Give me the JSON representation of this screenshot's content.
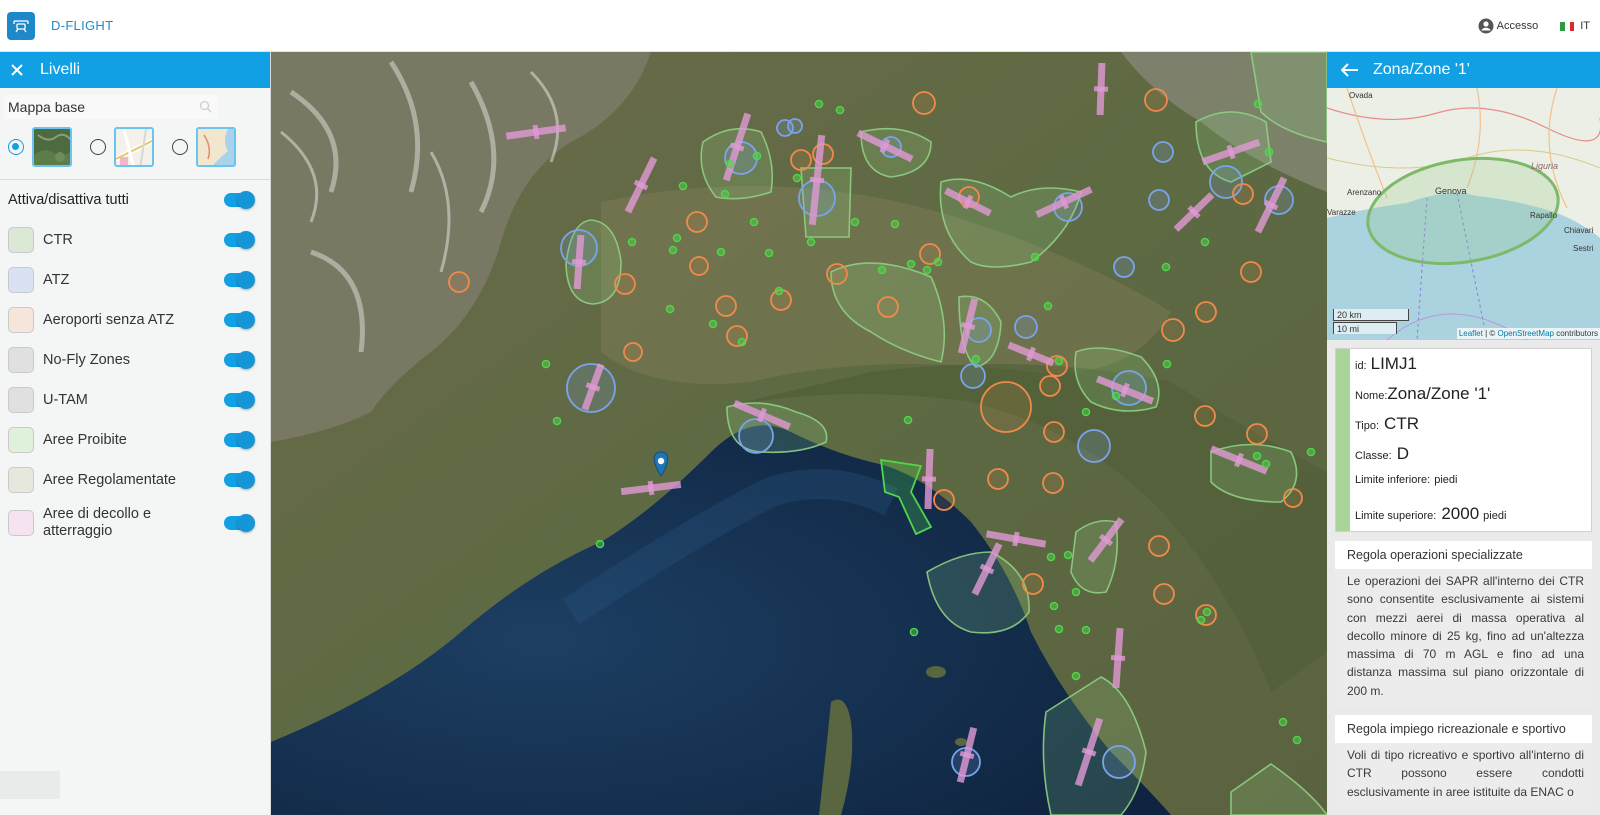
{
  "header": {
    "brand": "D-FLIGHT",
    "login_label": "Accesso",
    "lang_label": "IT"
  },
  "left_panel": {
    "title": "Livelli",
    "basemap_label": "Mappa base",
    "toggle_all_label": "Attiva/disattiva tutti",
    "layers": [
      {
        "label": "CTR",
        "color": "#dbe8d5"
      },
      {
        "label": "ATZ",
        "color": "#d9e2f3"
      },
      {
        "label": "Aeroporti senza ATZ",
        "color": "#f6e5da"
      },
      {
        "label": "No-Fly Zones",
        "color": "#e0e0e0"
      },
      {
        "label": "U-TAM",
        "color": "#e0e0e0"
      },
      {
        "label": "Aree Proibite",
        "color": "#dff1db"
      },
      {
        "label": "Aree Regolamentate",
        "color": "#e6e8dc"
      },
      {
        "label": "Aree di decollo e atterraggio",
        "color": "#f5e3f1"
      }
    ]
  },
  "right_panel": {
    "title": "Zona/Zone '1'",
    "minimap": {
      "places": [
        "Ovada",
        "Arenzano",
        "Genova",
        "Liguria",
        "Varazze",
        "Rapallo",
        "Chiavari",
        "Sestri"
      ],
      "scale_km": "20 km",
      "scale_mi": "10 mi",
      "attrib_leaflet": "Leaflet",
      "attrib_sep": " | © ",
      "attrib_osm": "OpenStreetMap",
      "attrib_contrib": " contributors"
    },
    "info": {
      "id_label": "id:",
      "id_value": "LIMJ1",
      "name_label": "Nome:",
      "name_value": "Zona/Zone '1'",
      "type_label": "Tipo:",
      "type_value": "CTR",
      "class_label": "Classe:",
      "class_value": "D",
      "lower_label": "Limite inferiore:",
      "lower_unit": "piedi",
      "upper_label": "Limite superiore:",
      "upper_value": "2000",
      "upper_unit": "piedi"
    },
    "rules": [
      {
        "title": "Regola operazioni specializzate",
        "text": "Le operazioni dei SAPR all'interno dei CTR sono consentite esclusivamente ai sistemi con mezzi aerei di massa operativa al decollo minore di 25 kg, fino ad un'altezza massima di 70 m AGL e fino ad una distanza massima sul piano orizzontale di 200 m."
      },
      {
        "title": "Regola impiego ricreazionale e sportivo",
        "text": "Voli di tipo ricreativo e sportivo all'interno di CTR possono essere condotti esclusivamente in aree istituite da ENAC o"
      }
    ]
  },
  "colors": {
    "accent": "#12a0e4",
    "ctr": "#8fd184",
    "atz": "#7aa4ea",
    "airport": "#f08a4b",
    "takeoff": "#e29ad6",
    "green_pt": "#4fd64a"
  }
}
